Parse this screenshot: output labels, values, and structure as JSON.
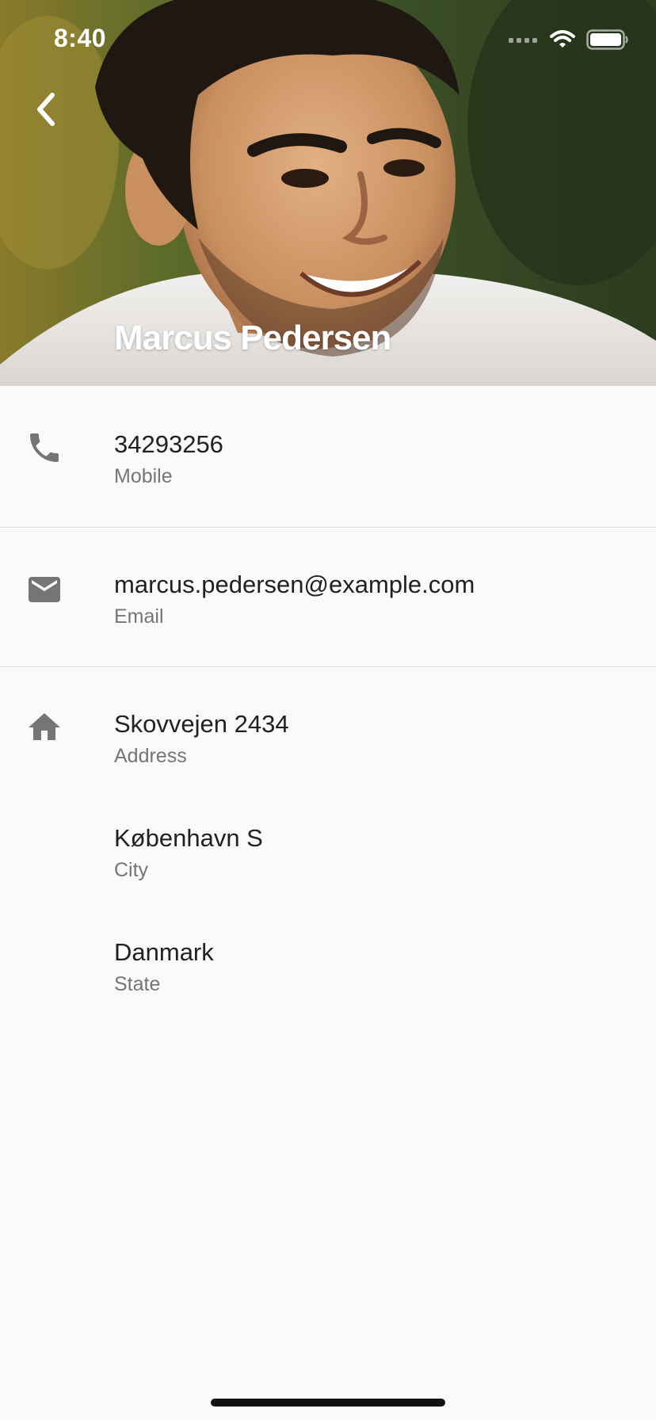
{
  "status_bar": {
    "time": "8:40",
    "signal_icon": "cellular-signal-icon",
    "wifi_icon": "wifi-icon",
    "battery_icon": "battery-icon"
  },
  "header": {
    "back_icon": "chevron-left-icon",
    "name": "Marcus Pedersen",
    "photo": "profile-photo"
  },
  "details": {
    "phone": {
      "icon": "phone-icon",
      "value": "34293256",
      "label": "Mobile"
    },
    "email": {
      "icon": "email-icon",
      "value": "marcus.pedersen@example.com",
      "label": "Email"
    },
    "address": {
      "icon": "home-icon",
      "street": {
        "value": "Skovvejen 2434",
        "label": "Address"
      },
      "city": {
        "value": "København S",
        "label": "City"
      },
      "state": {
        "value": "Danmark",
        "label": "State"
      }
    }
  },
  "colors": {
    "icon_gray": "#757575",
    "divider": "#dcdcdc",
    "background": "#fafafa",
    "primary_text": "#212121",
    "secondary_text": "#757575"
  }
}
